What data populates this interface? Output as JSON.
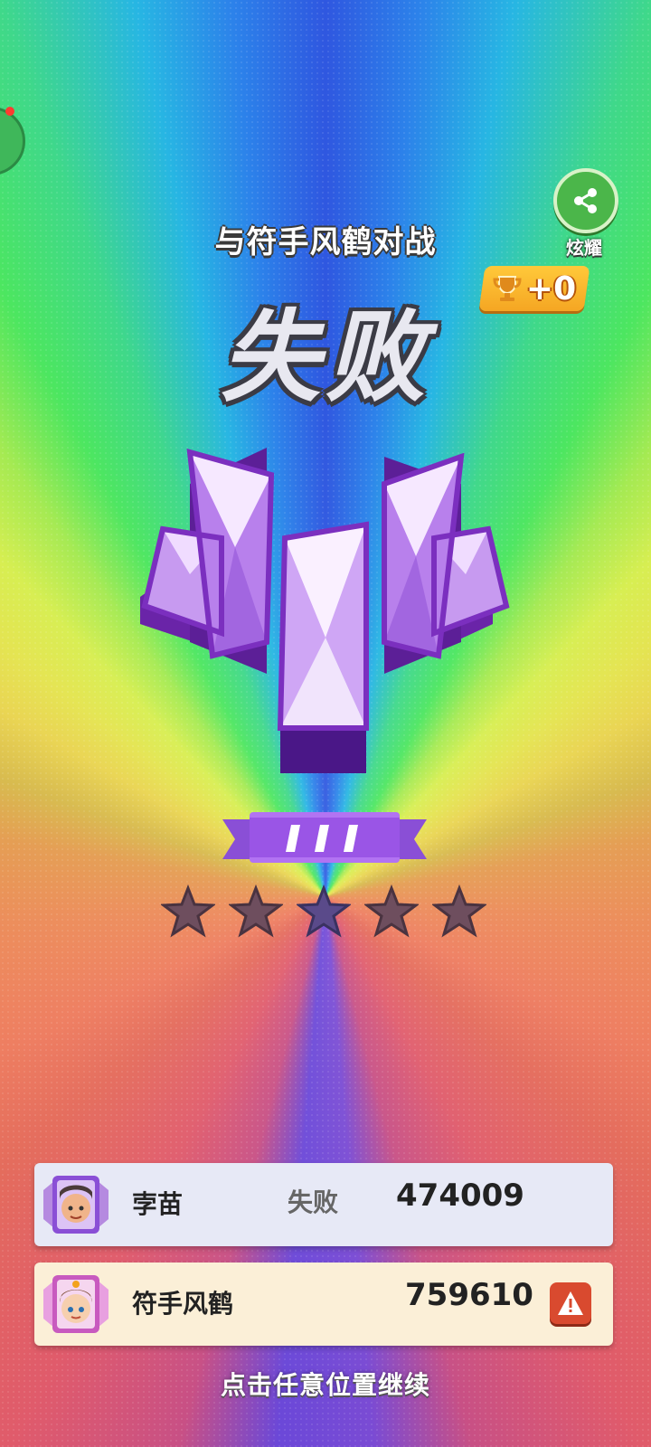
{
  "header": {
    "title": "与符手风鹤对战",
    "share_label": "炫耀",
    "trophy_delta": "+0",
    "result": "失败"
  },
  "rank": {
    "tier_icon": "crystal-rank-icon",
    "division": "III",
    "stars_filled": 0,
    "stars_total": 5
  },
  "players": [
    {
      "name": "孛苗",
      "status": "失败",
      "score": "474009",
      "avatar": "boy-avatar-icon"
    },
    {
      "name": "符手风鹤",
      "status": "",
      "score": "759610",
      "avatar": "girl-avatar-icon",
      "action_icon": "warning-icon"
    }
  ],
  "footer": {
    "continue_hint": "点击任意位置继续"
  },
  "colors": {
    "share_green": "#4bb64a",
    "trophy_gold": "#f5a623",
    "crystal_purple": "#7b2fbf",
    "report_red": "#d94a2f"
  }
}
